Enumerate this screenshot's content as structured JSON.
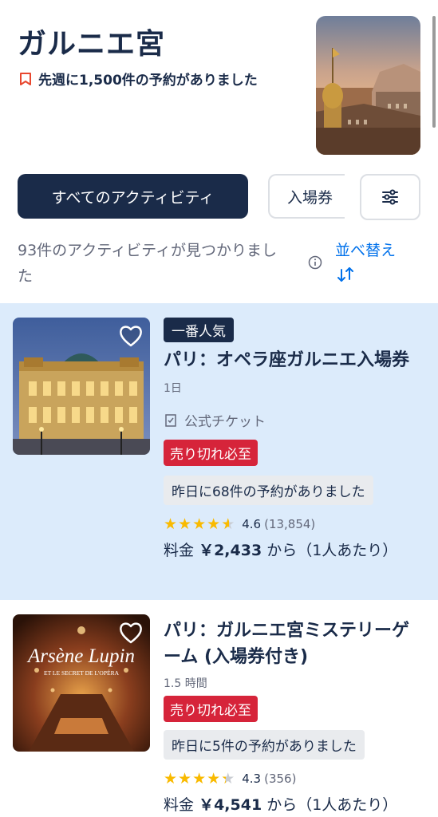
{
  "header": {
    "title": "ガルニエ宮",
    "booked_text": "先週に1,500件の予約がありました"
  },
  "filters": {
    "all_activities": "すべてのアクティビティ",
    "tickets": "入場券"
  },
  "results": {
    "count_text": "93件のアクティビティが見つかりました",
    "sort_label": "並べ替え"
  },
  "cards": [
    {
      "badge": "一番人気",
      "title": "パリ：オペラ座ガルニエ入場券",
      "duration": "1日",
      "official": "公式チケット",
      "sellout": "売り切れ必至",
      "booked_yesterday": "昨日に68件の予約がありました",
      "rating": "4.6",
      "reviews": "(13,854)",
      "price_prefix": "料金",
      "price": "￥2,433",
      "price_suffix": "から（1人あたり）"
    },
    {
      "title": "パリ：ガルニエ宮ミステリーゲーム (入場券付き)",
      "duration": "1.5 時間",
      "sellout": "売り切れ必至",
      "booked_yesterday": "昨日に5件の予約がありました",
      "rating": "4.3",
      "reviews": "(356)",
      "price_prefix": "料金",
      "price": "￥4,541",
      "price_suffix": "から（1人あたり）",
      "image_text": [
        "Arsène Lupin",
        "ET LE SECRET DE L'OPÉRA"
      ]
    }
  ],
  "colors": {
    "navy": "#1a2b49",
    "link_blue": "#0071eb",
    "sellout_red": "#d6243a",
    "star_yellow": "#f9ba00",
    "highlight_bg": "#dcebfb"
  },
  "icons": [
    "tag-icon",
    "filter-sliders-icon",
    "info-icon",
    "sort-arrows-icon",
    "heart-icon",
    "official-ticket-icon",
    "star-icon"
  ]
}
